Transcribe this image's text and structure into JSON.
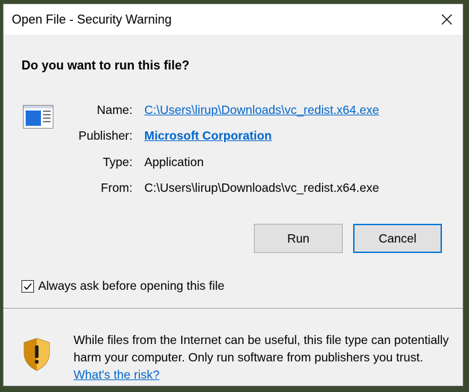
{
  "window": {
    "title": "Open File - Security Warning"
  },
  "dialog": {
    "heading": "Do you want to run this file?",
    "name_label": "Name:",
    "name_value": "C:\\Users\\lirup\\Downloads\\vc_redist.x64.exe",
    "publisher_label": "Publisher:",
    "publisher_value": "Microsoft Corporation",
    "type_label": "Type:",
    "type_value": "Application",
    "from_label": "From:",
    "from_value": "C:\\Users\\lirup\\Downloads\\vc_redist.x64.exe"
  },
  "buttons": {
    "run": "Run",
    "cancel": "Cancel"
  },
  "checkbox": {
    "label": "Always ask before opening this file",
    "checked": true
  },
  "warning": {
    "text": "While files from the Internet can be useful, this file type can potentially harm your computer. Only run software from publishers you trust.",
    "link": "What's the risk?"
  },
  "icons": {
    "app": "application-icon",
    "shield": "security-shield-icon",
    "close": "close-icon",
    "check": "checkmark-icon"
  },
  "colors": {
    "link": "#0066cc",
    "accent": "#0078d7"
  }
}
